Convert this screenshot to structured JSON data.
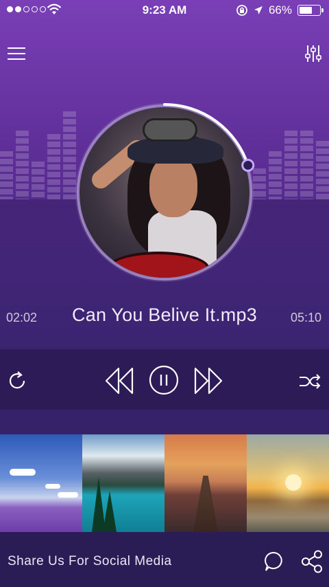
{
  "status_bar": {
    "time": "9:23 AM",
    "battery": "66%",
    "signal_filled": 2,
    "signal_total": 5,
    "battery_level": 0.66
  },
  "header": {
    "menu_icon": "hamburger-menu-icon",
    "equalizer_icon": "equalizer-sliders-icon"
  },
  "player": {
    "elapsed": "02:02",
    "duration": "05:10",
    "track_title": "Can You Belive It.mp3",
    "progress": 0.39
  },
  "controls": {
    "repeat_icon": "repeat-icon",
    "rewind_icon": "rewind-icon",
    "pause_icon": "pause-icon",
    "forward_icon": "fast-forward-icon",
    "shuffle_icon": "shuffle-icon"
  },
  "gallery": [
    "lavender-field",
    "mountain-lake",
    "wooden-pier-sunset",
    "coast-sunset"
  ],
  "footer": {
    "label": "Share Us For Social Media",
    "chat_icon": "chat-bubble-icon",
    "share_icon": "share-icon"
  },
  "colors": {
    "accent": "#8b4fd0",
    "background_top": "#7a3fb6",
    "background_bottom": "#2c1f5c"
  }
}
